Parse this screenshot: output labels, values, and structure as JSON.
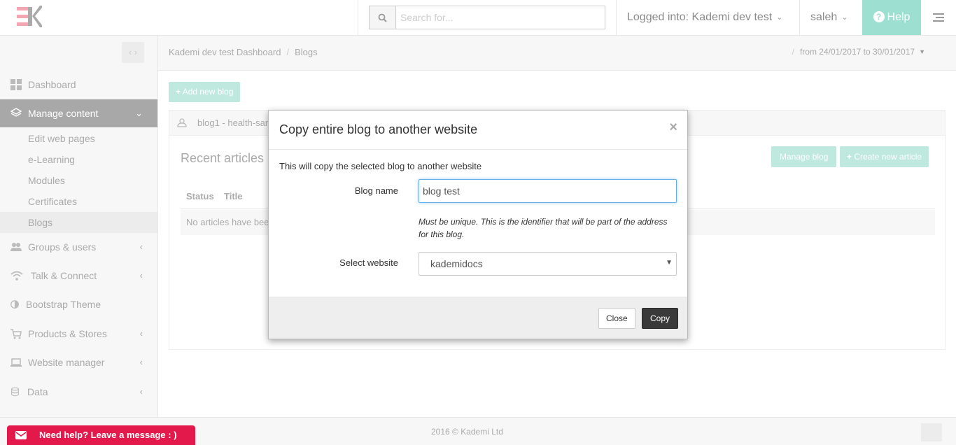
{
  "header": {
    "search_placeholder": "Search for...",
    "logged_into": "Logged into: Kademi dev test",
    "user": "saleh",
    "help_label": "Help"
  },
  "sidebar": {
    "collapse_label": "< >",
    "items": [
      {
        "label": "Dashboard",
        "icon": "dashboard-icon"
      },
      {
        "label": "Manage content",
        "icon": "layers-icon",
        "active": true
      },
      {
        "label": "Groups & users",
        "icon": "users-icon"
      },
      {
        "label": "Talk & Connect",
        "icon": "wifi-icon"
      },
      {
        "label": "Bootstrap Theme",
        "icon": "contrast-icon"
      },
      {
        "label": "Products & Stores",
        "icon": "cart-icon"
      },
      {
        "label": "Website manager",
        "icon": "laptop-icon"
      },
      {
        "label": "Data",
        "icon": "database-icon"
      }
    ],
    "subitems": [
      {
        "label": "Edit web pages"
      },
      {
        "label": "e-Learning"
      },
      {
        "label": "Modules"
      },
      {
        "label": "Certificates"
      },
      {
        "label": "Blogs",
        "current": true
      }
    ]
  },
  "breadcrumb": {
    "root": "Kademi dev test Dashboard",
    "current": "Blogs",
    "daterange": "from 24/01/2017 to 30/01/2017"
  },
  "content": {
    "add_blog": "Add new blog",
    "blog_heading": "blog1 - health-sam",
    "recent_title": "Recent articles",
    "manage_blog": "Manage blog",
    "create_article": "Create new article",
    "columns": [
      "Status",
      "Title"
    ],
    "empty_text": "No articles have bee"
  },
  "modal": {
    "title": "Copy entire blog to another website",
    "close_x": "×",
    "intro": "This will copy the selected blog to another website",
    "blog_name_label": "Blog name",
    "blog_name_value": "blog test",
    "blog_name_help": "Must be unique. This is the identifier that will be part of the address for this blog.",
    "website_label": "Select website",
    "website_value": "kademidocs",
    "close_button": "Close",
    "copy_button": "Copy"
  },
  "footer": {
    "copyright": "2016 © Kademi Ltd",
    "chat_label": "Need help? Leave a message : )"
  },
  "colors": {
    "accent": "#9ddfd1",
    "chat": "#e3194b",
    "primary_dark": "#3a3a3a"
  }
}
